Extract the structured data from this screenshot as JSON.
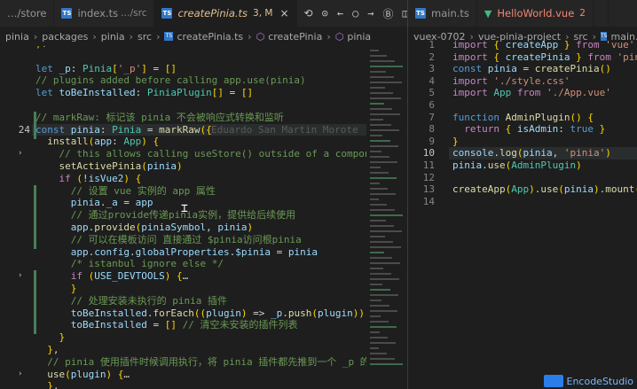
{
  "left_tabs": [
    {
      "icon": "",
      "label": "…/store",
      "dim": "",
      "mod": "",
      "active": false,
      "close": false
    },
    {
      "icon": "ts",
      "label": "index.ts",
      "dim": "…/src",
      "mod": "",
      "active": false,
      "close": false
    },
    {
      "icon": "ts",
      "label": "createPinia.ts",
      "dim": "",
      "mod": "3, M",
      "active": true,
      "close": true
    }
  ],
  "right_tabs": [
    {
      "icon": "ts",
      "label": "main.ts",
      "mod": "",
      "active": false
    },
    {
      "icon": "vue",
      "label": "HelloWorld.vue",
      "mod": "2",
      "active": false
    },
    {
      "icon": "",
      "label": "",
      "mod": "",
      "active": false
    }
  ],
  "left_breadcrumb": [
    "pinia",
    "packages",
    "pinia",
    "src",
    "createPinia.ts",
    "createPinia",
    "pinia"
  ],
  "right_breadcrumb": [
    "vuex-0702",
    "vue-pinia-project",
    "src",
    "main.ts"
  ],
  "blame_text": "Eduardo San Martin Morote",
  "watermark": "EncodeStudio",
  "left_lines": [
    {
      "n": "",
      "text": ")!"
    },
    {
      "n": "",
      "text": ""
    },
    {
      "n": "",
      "text": "let _p: Pinia['_p'] = []"
    },
    {
      "n": "",
      "text": "// plugins added before calling app.use(pinia)"
    },
    {
      "n": "",
      "text": "let toBeInstalled: PiniaPlugin[] = []"
    },
    {
      "n": "",
      "text": ""
    },
    {
      "n": "",
      "text": "// markRaw: 标记该 pinia 不会被响应式转换和监听"
    },
    {
      "n": "24",
      "text": "const pinia: Pinia = markRaw({"
    },
    {
      "n": "",
      "text": "  install(app: App) {"
    },
    {
      "n": "",
      "text": "    // this allows calling useStore() outside of a component setup"
    },
    {
      "n": "",
      "text": "    setActivePinia(pinia)"
    },
    {
      "n": "",
      "text": "    if (!isVue2) {"
    },
    {
      "n": "",
      "text": "      // 设置 vue 实例的 app 属性"
    },
    {
      "n": "",
      "text": "      pinia._a = app"
    },
    {
      "n": "",
      "text": "      // 通过provide传递pinia实例，提供给后续使用"
    },
    {
      "n": "",
      "text": "      app.provide(piniaSymbol, pinia)"
    },
    {
      "n": "",
      "text": "      // 可以在模板访问 直接通过 $pinia访问根pinia"
    },
    {
      "n": "",
      "text": "      app.config.globalProperties.$pinia = pinia"
    },
    {
      "n": "",
      "text": "      /* istanbul ignore else */"
    },
    {
      "n": "",
      "text": "      if (USE_DEVTOOLS) {…"
    },
    {
      "n": "",
      "text": "      }"
    },
    {
      "n": "",
      "text": "      // 处理安装未执行的 pinia 插件"
    },
    {
      "n": "",
      "text": "      toBeInstalled.forEach((plugin) => _p.push(plugin))"
    },
    {
      "n": "",
      "text": "      toBeInstalled = [] // 清空未安装的插件列表"
    },
    {
      "n": "",
      "text": "    }"
    },
    {
      "n": "",
      "text": "  },"
    },
    {
      "n": "",
      "text": "  // pinia 使用插件时候调用执行，将 pinia 插件都先推到一个 _p 的数组中，后续在"
    },
    {
      "n": "",
      "text": "  use(plugin) {…"
    },
    {
      "n": "",
      "text": "  },"
    }
  ],
  "right_lines": [
    {
      "n": "1",
      "text": "import { createApp } from 'vue'"
    },
    {
      "n": "2",
      "text": "import { createPinia } from 'pinia'"
    },
    {
      "n": "3",
      "text": "const pinia = createPinia()"
    },
    {
      "n": "4",
      "text": "import './style.css'"
    },
    {
      "n": "5",
      "text": "import App from './App.vue'"
    },
    {
      "n": "6",
      "text": ""
    },
    {
      "n": "7",
      "text": "function AdminPlugin() {"
    },
    {
      "n": "8",
      "text": "  return { isAdmin: true }"
    },
    {
      "n": "9",
      "text": "}"
    },
    {
      "n": "10",
      "text": "console.log(pinia, 'pinia')"
    },
    {
      "n": "11",
      "text": "pinia.use(AdminPlugin)"
    },
    {
      "n": "12",
      "text": ""
    },
    {
      "n": "13",
      "text": "createApp(App).use(pinia).mount('#app')"
    },
    {
      "n": "14",
      "text": ""
    }
  ],
  "colors": {
    "bg": "#1e1e1e",
    "tabbar": "#252526",
    "keyword": "#569cd6",
    "string": "#ce9178",
    "comment": "#6a9955",
    "function": "#dcdcaa",
    "type": "#4ec9b0"
  }
}
